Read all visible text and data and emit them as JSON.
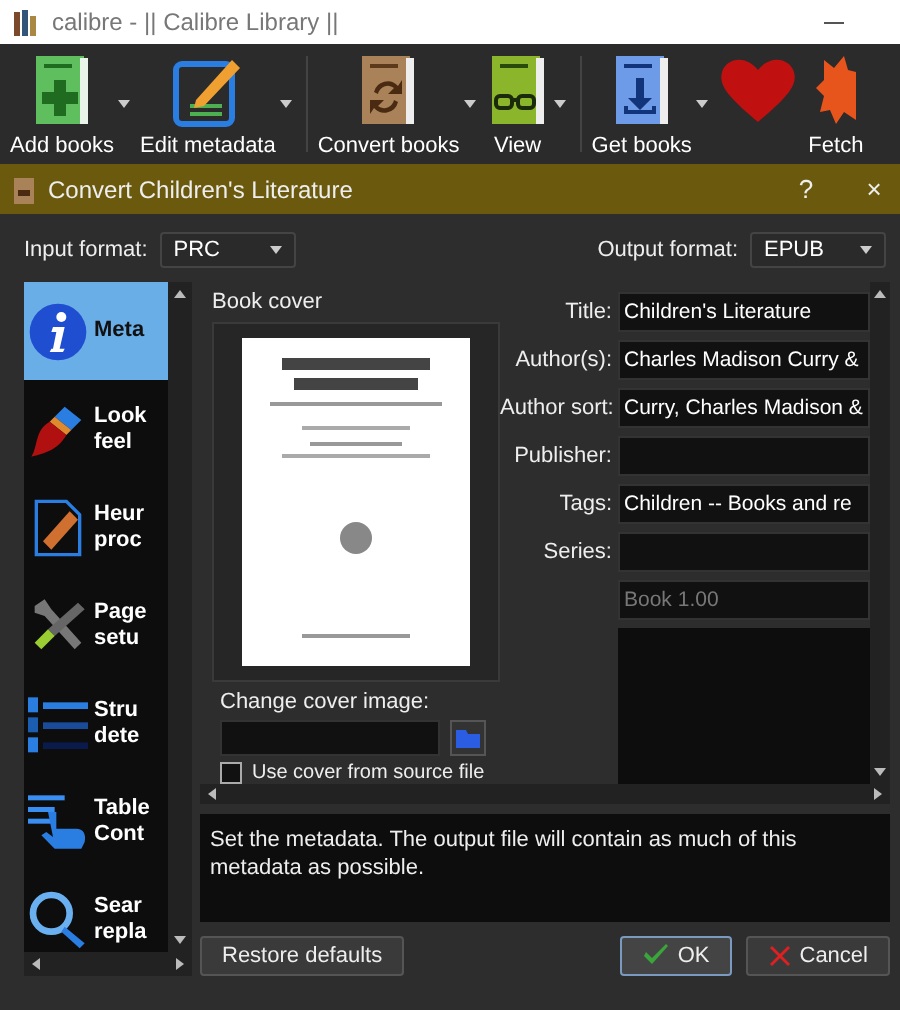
{
  "window": {
    "title": "calibre - || Calibre Library ||"
  },
  "toolbar": [
    {
      "kind": "add",
      "label": "Add books",
      "menu": true
    },
    {
      "kind": "edit",
      "label": "Edit metadata",
      "menu": true
    },
    {
      "kind": "convert",
      "label": "Convert books",
      "menu": true
    },
    {
      "kind": "view",
      "label": "View",
      "menu": true
    },
    {
      "kind": "get",
      "label": "Get books",
      "menu": true
    },
    {
      "kind": "donate",
      "menu": false
    },
    {
      "kind": "fetch",
      "label": "Fetch",
      "menu": false
    }
  ],
  "dialog": {
    "title": "Convert Children's Literature",
    "help": "?",
    "close": "×",
    "input_format": {
      "label": "Input format:",
      "value": "PRC"
    },
    "output_format": {
      "label": "Output format:",
      "value": "EPUB"
    },
    "sections": [
      {
        "kind": "metadata",
        "lines": [
          "Meta"
        ],
        "selected": true
      },
      {
        "kind": "look",
        "lines": [
          "Look",
          "feel"
        ],
        "selected": false
      },
      {
        "kind": "heuristic",
        "lines": [
          "Heur",
          "proc"
        ],
        "selected": false
      },
      {
        "kind": "page",
        "lines": [
          "Page",
          "setu"
        ],
        "selected": false
      },
      {
        "kind": "structure",
        "lines": [
          "Stru",
          "dete"
        ],
        "selected": false
      },
      {
        "kind": "toc",
        "lines": [
          "Table",
          "Cont"
        ],
        "selected": false
      },
      {
        "kind": "search",
        "lines": [
          "Sear",
          "repla"
        ],
        "selected": false
      }
    ],
    "cover": {
      "heading": "Book cover",
      "kind": "picture",
      "change_label": "Change cover image:",
      "use_source": {
        "label": "Use cover from source file",
        "checked": false
      }
    },
    "fields": [
      {
        "label": "Title:",
        "value": "Children's Literature"
      },
      {
        "label": "Author(s):",
        "value": "Charles Madison Curry &"
      },
      {
        "label": "Author sort:",
        "value": "Curry, Charles Madison &"
      },
      {
        "label": "Publisher:"
      },
      {
        "label": "Tags:",
        "value": "Children -- Books and re"
      },
      {
        "label": "Series:"
      }
    ],
    "series_index": {
      "value": "Book 1.00",
      "disabled": true
    },
    "description": "Set the metadata. The output file will contain as much of this metadata as possible.",
    "buttons": [
      {
        "kind": "restore",
        "label": "Restore defaults",
        "default": false
      },
      {
        "kind": "ok",
        "label": "OK",
        "default": true
      },
      {
        "kind": "cancel",
        "label": "Cancel",
        "default": false
      }
    ]
  }
}
